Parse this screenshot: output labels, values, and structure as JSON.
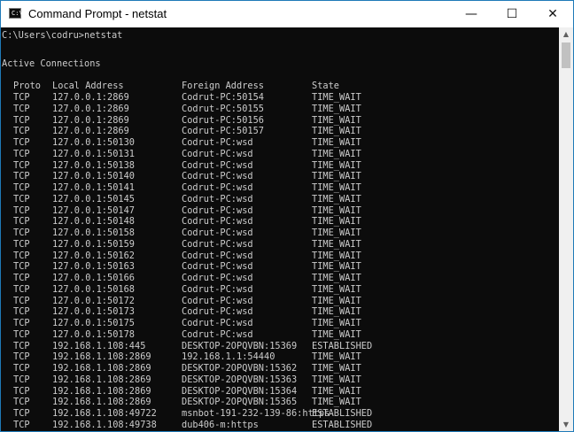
{
  "window": {
    "title": "Command Prompt - netstat",
    "icon_text": "C:\\",
    "buttons": {
      "minimize": "—",
      "maximize": "☐",
      "close": "✕"
    }
  },
  "console": {
    "blank_top": "",
    "prompt": "C:\\Users\\codru>netstat",
    "heading": "Active Connections",
    "columns": {
      "proto": "Proto",
      "local": "Local Address",
      "foreign": "Foreign Address",
      "state": "State"
    },
    "rows": [
      {
        "proto": "TCP",
        "local": "127.0.0.1:2869",
        "foreign": "Codrut-PC:50154",
        "state": "TIME_WAIT"
      },
      {
        "proto": "TCP",
        "local": "127.0.0.1:2869",
        "foreign": "Codrut-PC:50155",
        "state": "TIME_WAIT"
      },
      {
        "proto": "TCP",
        "local": "127.0.0.1:2869",
        "foreign": "Codrut-PC:50156",
        "state": "TIME_WAIT"
      },
      {
        "proto": "TCP",
        "local": "127.0.0.1:2869",
        "foreign": "Codrut-PC:50157",
        "state": "TIME_WAIT"
      },
      {
        "proto": "TCP",
        "local": "127.0.0.1:50130",
        "foreign": "Codrut-PC:wsd",
        "state": "TIME_WAIT"
      },
      {
        "proto": "TCP",
        "local": "127.0.0.1:50131",
        "foreign": "Codrut-PC:wsd",
        "state": "TIME_WAIT"
      },
      {
        "proto": "TCP",
        "local": "127.0.0.1:50138",
        "foreign": "Codrut-PC:wsd",
        "state": "TIME_WAIT"
      },
      {
        "proto": "TCP",
        "local": "127.0.0.1:50140",
        "foreign": "Codrut-PC:wsd",
        "state": "TIME_WAIT"
      },
      {
        "proto": "TCP",
        "local": "127.0.0.1:50141",
        "foreign": "Codrut-PC:wsd",
        "state": "TIME_WAIT"
      },
      {
        "proto": "TCP",
        "local": "127.0.0.1:50145",
        "foreign": "Codrut-PC:wsd",
        "state": "TIME_WAIT"
      },
      {
        "proto": "TCP",
        "local": "127.0.0.1:50147",
        "foreign": "Codrut-PC:wsd",
        "state": "TIME_WAIT"
      },
      {
        "proto": "TCP",
        "local": "127.0.0.1:50148",
        "foreign": "Codrut-PC:wsd",
        "state": "TIME_WAIT"
      },
      {
        "proto": "TCP",
        "local": "127.0.0.1:50158",
        "foreign": "Codrut-PC:wsd",
        "state": "TIME_WAIT"
      },
      {
        "proto": "TCP",
        "local": "127.0.0.1:50159",
        "foreign": "Codrut-PC:wsd",
        "state": "TIME_WAIT"
      },
      {
        "proto": "TCP",
        "local": "127.0.0.1:50162",
        "foreign": "Codrut-PC:wsd",
        "state": "TIME_WAIT"
      },
      {
        "proto": "TCP",
        "local": "127.0.0.1:50163",
        "foreign": "Codrut-PC:wsd",
        "state": "TIME_WAIT"
      },
      {
        "proto": "TCP",
        "local": "127.0.0.1:50166",
        "foreign": "Codrut-PC:wsd",
        "state": "TIME_WAIT"
      },
      {
        "proto": "TCP",
        "local": "127.0.0.1:50168",
        "foreign": "Codrut-PC:wsd",
        "state": "TIME_WAIT"
      },
      {
        "proto": "TCP",
        "local": "127.0.0.1:50172",
        "foreign": "Codrut-PC:wsd",
        "state": "TIME_WAIT"
      },
      {
        "proto": "TCP",
        "local": "127.0.0.1:50173",
        "foreign": "Codrut-PC:wsd",
        "state": "TIME_WAIT"
      },
      {
        "proto": "TCP",
        "local": "127.0.0.1:50175",
        "foreign": "Codrut-PC:wsd",
        "state": "TIME_WAIT"
      },
      {
        "proto": "TCP",
        "local": "127.0.0.1:50178",
        "foreign": "Codrut-PC:wsd",
        "state": "TIME_WAIT"
      },
      {
        "proto": "TCP",
        "local": "192.168.1.108:445",
        "foreign": "DESKTOP-2OPQVBN:15369",
        "state": "ESTABLISHED"
      },
      {
        "proto": "TCP",
        "local": "192.168.1.108:2869",
        "foreign": "192.168.1.1:54440",
        "state": "TIME_WAIT"
      },
      {
        "proto": "TCP",
        "local": "192.168.1.108:2869",
        "foreign": "DESKTOP-2OPQVBN:15362",
        "state": "TIME_WAIT"
      },
      {
        "proto": "TCP",
        "local": "192.168.1.108:2869",
        "foreign": "DESKTOP-2OPQVBN:15363",
        "state": "TIME_WAIT"
      },
      {
        "proto": "TCP",
        "local": "192.168.1.108:2869",
        "foreign": "DESKTOP-2OPQVBN:15364",
        "state": "TIME_WAIT"
      },
      {
        "proto": "TCP",
        "local": "192.168.1.108:2869",
        "foreign": "DESKTOP-2OPQVBN:15365",
        "state": "TIME_WAIT"
      },
      {
        "proto": "TCP",
        "local": "192.168.1.108:49722",
        "foreign": "msnbot-191-232-139-86:https",
        "state": "ESTABLISHED"
      },
      {
        "proto": "TCP",
        "local": "192.168.1.108:49738",
        "foreign": "dub406-m:https",
        "state": "ESTABLISHED"
      }
    ]
  },
  "scrollbar": {
    "thumb_fraction": 0.07,
    "up_arrow": "▲",
    "down_arrow": "▼"
  },
  "colors": {
    "console_bg": "#0c0c0c",
    "console_text": "#cccccc",
    "titlebar_bg": "#ffffff",
    "window_border": "#1f7ab8"
  }
}
